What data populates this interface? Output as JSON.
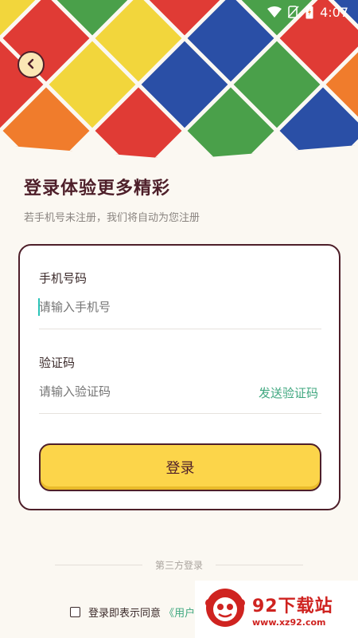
{
  "status_bar": {
    "time": "4:07",
    "icons": [
      "wifi-icon",
      "signal-off-icon",
      "battery-charging-icon"
    ]
  },
  "header": {
    "back_icon": "chevron-left-icon",
    "hero_colors": [
      "#e03b35",
      "#f07c2c",
      "#f2d63c",
      "#4aa04a",
      "#2a4fa6"
    ]
  },
  "page": {
    "title": "登录体验更多精彩",
    "subtitle": "若手机号未注册，我们将自动为您注册"
  },
  "form": {
    "phone_label": "手机号码",
    "phone_placeholder": "请输入手机号",
    "phone_value": "",
    "code_label": "验证码",
    "code_placeholder": "请输入验证码",
    "code_value": "",
    "send_code_label": "发送验证码",
    "login_label": "登录"
  },
  "third_party": {
    "label": "第三方登录"
  },
  "agreement": {
    "text": "登录即表示同意",
    "link": "《用户"
  },
  "watermark": {
    "title": "92下载站",
    "url": "www.xz92.com"
  },
  "colors": {
    "accent": "#fcd54a",
    "brand_dark": "#4e1f2a",
    "link": "#3fa77f",
    "caret": "#2ac3b8"
  }
}
